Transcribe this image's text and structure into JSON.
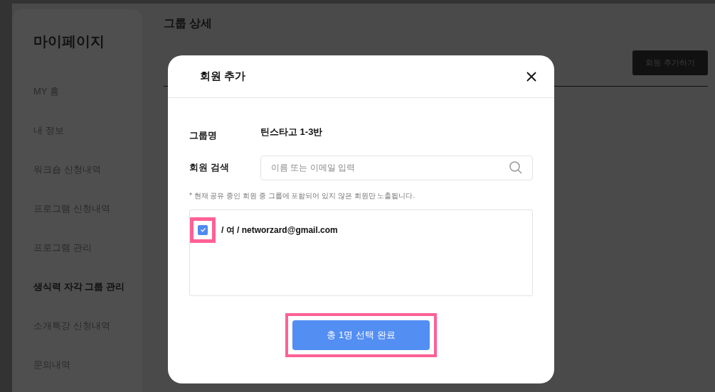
{
  "sidebar": {
    "title": "마이페이지",
    "items": [
      {
        "label": "MY 홈",
        "selected": false
      },
      {
        "label": "내 정보",
        "selected": false
      },
      {
        "label": "워크숍 신청내역",
        "selected": false
      },
      {
        "label": "프로그램 신청내역",
        "selected": false
      },
      {
        "label": "프로그램 관리",
        "selected": false
      },
      {
        "label": "생식력 자각 그룹 관리",
        "selected": true
      },
      {
        "label": "소개특강 신청내역",
        "selected": false
      },
      {
        "label": "문의내역",
        "selected": false
      }
    ]
  },
  "page": {
    "title": "그룹 상세",
    "add_button": "회원 추가하기"
  },
  "dialog": {
    "title": "회원 추가",
    "group_label": "그룹명",
    "group_name": "틴스타고 1-3반",
    "search_label": "회원 검색",
    "search": {
      "placeholder": "이름 또는 이메일 입력"
    },
    "note": "* 현재 공유 중인 회원 중 그룹에 포함되어 있지 않은 회원만 노출됩니다.",
    "members": [
      {
        "text": "/ 여 / networzard@gmail.com",
        "checked": true,
        "highlighted": true
      }
    ],
    "confirm": {
      "label": "총 1명 선택 완료",
      "highlighted": true
    }
  }
}
